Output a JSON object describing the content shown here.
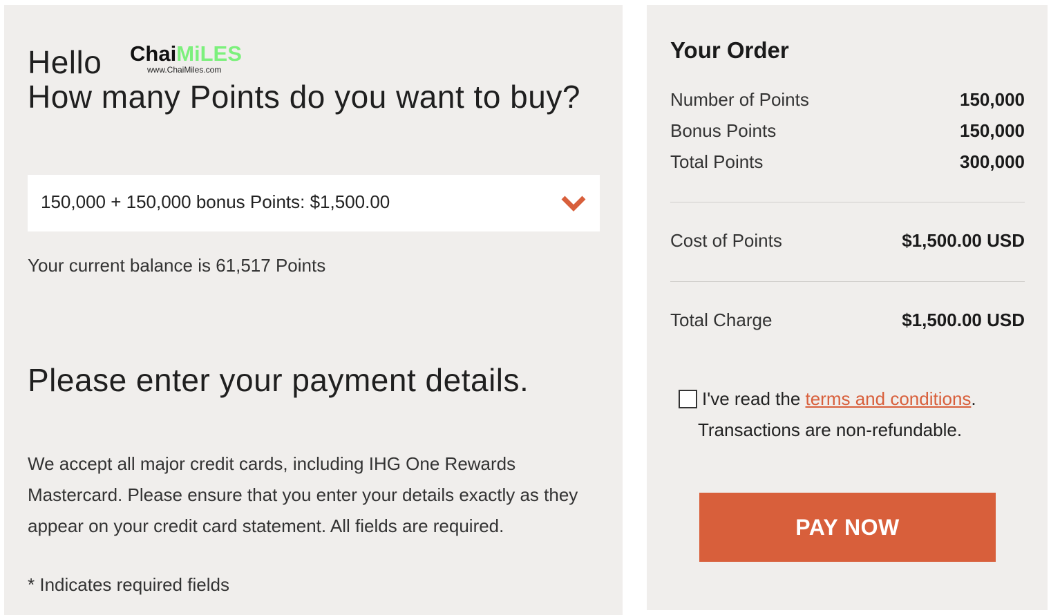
{
  "logo": {
    "brand_part1": "Chai",
    "brand_part2": "MiLES",
    "url": "www.ChaiMiles.com"
  },
  "left": {
    "greeting": "Hello",
    "question": "How many Points do you want to buy?",
    "select": {
      "selected_value": "150,000 + 150,000 bonus Points: $1,500.00",
      "icon": "chevron-down-icon"
    },
    "balance_text": "Your current balance is 61,517 Points",
    "payment_heading": "Please enter your payment details.",
    "payment_description": "We accept all major credit cards, including IHG One Rewards Mastercard. Please ensure that you enter your details exactly as they appear on your credit card statement. All fields are required.",
    "required_note": "* Indicates required fields"
  },
  "order": {
    "title": "Your Order",
    "number_of_points": {
      "label": "Number of Points",
      "value": "150,000"
    },
    "bonus_points": {
      "label": "Bonus Points",
      "value": "150,000"
    },
    "total_points": {
      "label": "Total Points",
      "value": "300,000"
    },
    "cost_of_points": {
      "label": "Cost of Points",
      "value": "$1,500.00 USD"
    },
    "total_charge": {
      "label": "Total Charge",
      "value": "$1,500.00 USD"
    },
    "terms": {
      "prefix": "I've read the ",
      "link_text": "terms and conditions",
      "suffix": ".",
      "non_refundable": "Transactions are non-refundable.",
      "checked": false
    },
    "pay_button_label": "PAY NOW"
  },
  "colors": {
    "accent": "#d85f3b",
    "panel_background": "#f0eeec",
    "logo_green": "#7cf07c"
  }
}
